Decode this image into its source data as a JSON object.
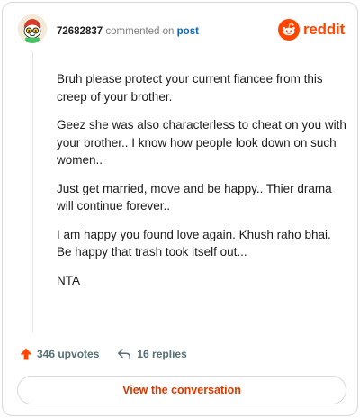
{
  "header": {
    "username": "72682837",
    "action_text": "commented on",
    "post_link": "post",
    "avatar_icon": "snoo-avatar-icon"
  },
  "brand": {
    "icon": "reddit-logo-icon",
    "wordmark": "reddit",
    "color": "#ff4500"
  },
  "comment": {
    "paragraphs": [
      "Bruh please protect your current fiancee from this creep of your brother.",
      "Geez she was also characterless to cheat on you with your brother.. I know how people look down on such women..",
      "Just get married, move and be happy.. Thier drama will continue forever..",
      "I am happy you found love again. Khush raho bhai. Be happy that trash took itself out...",
      "NTA"
    ]
  },
  "stats": {
    "upvotes_label": "346 upvotes",
    "upvote_icon": "upvote-arrow-icon",
    "upvote_color": "#ff4500",
    "replies_label": "16 replies",
    "reply_icon": "reply-arrow-icon"
  },
  "cta": {
    "label": "View the conversation",
    "color": "#d93a00"
  }
}
